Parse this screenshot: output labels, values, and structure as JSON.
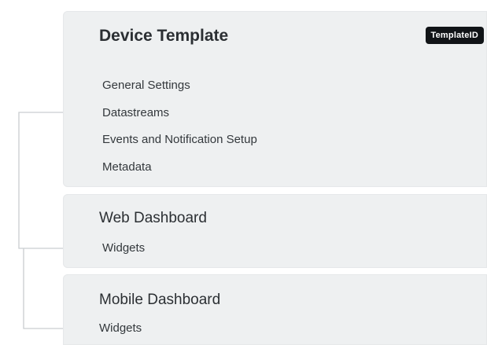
{
  "device_template": {
    "title": "Device Template",
    "badge": "TemplateID",
    "items": [
      "General Settings",
      "Datastreams",
      "Events and Notification Setup",
      "Metadata"
    ]
  },
  "web_dashboard": {
    "title": "Web Dashboard",
    "items": [
      "Widgets"
    ]
  },
  "mobile_dashboard": {
    "title": "Mobile Dashboard",
    "items": [
      "Widgets"
    ]
  },
  "colors": {
    "panel_bg": "#eef0f1",
    "badge_bg": "#111417",
    "connector": "#c9cdd0"
  }
}
